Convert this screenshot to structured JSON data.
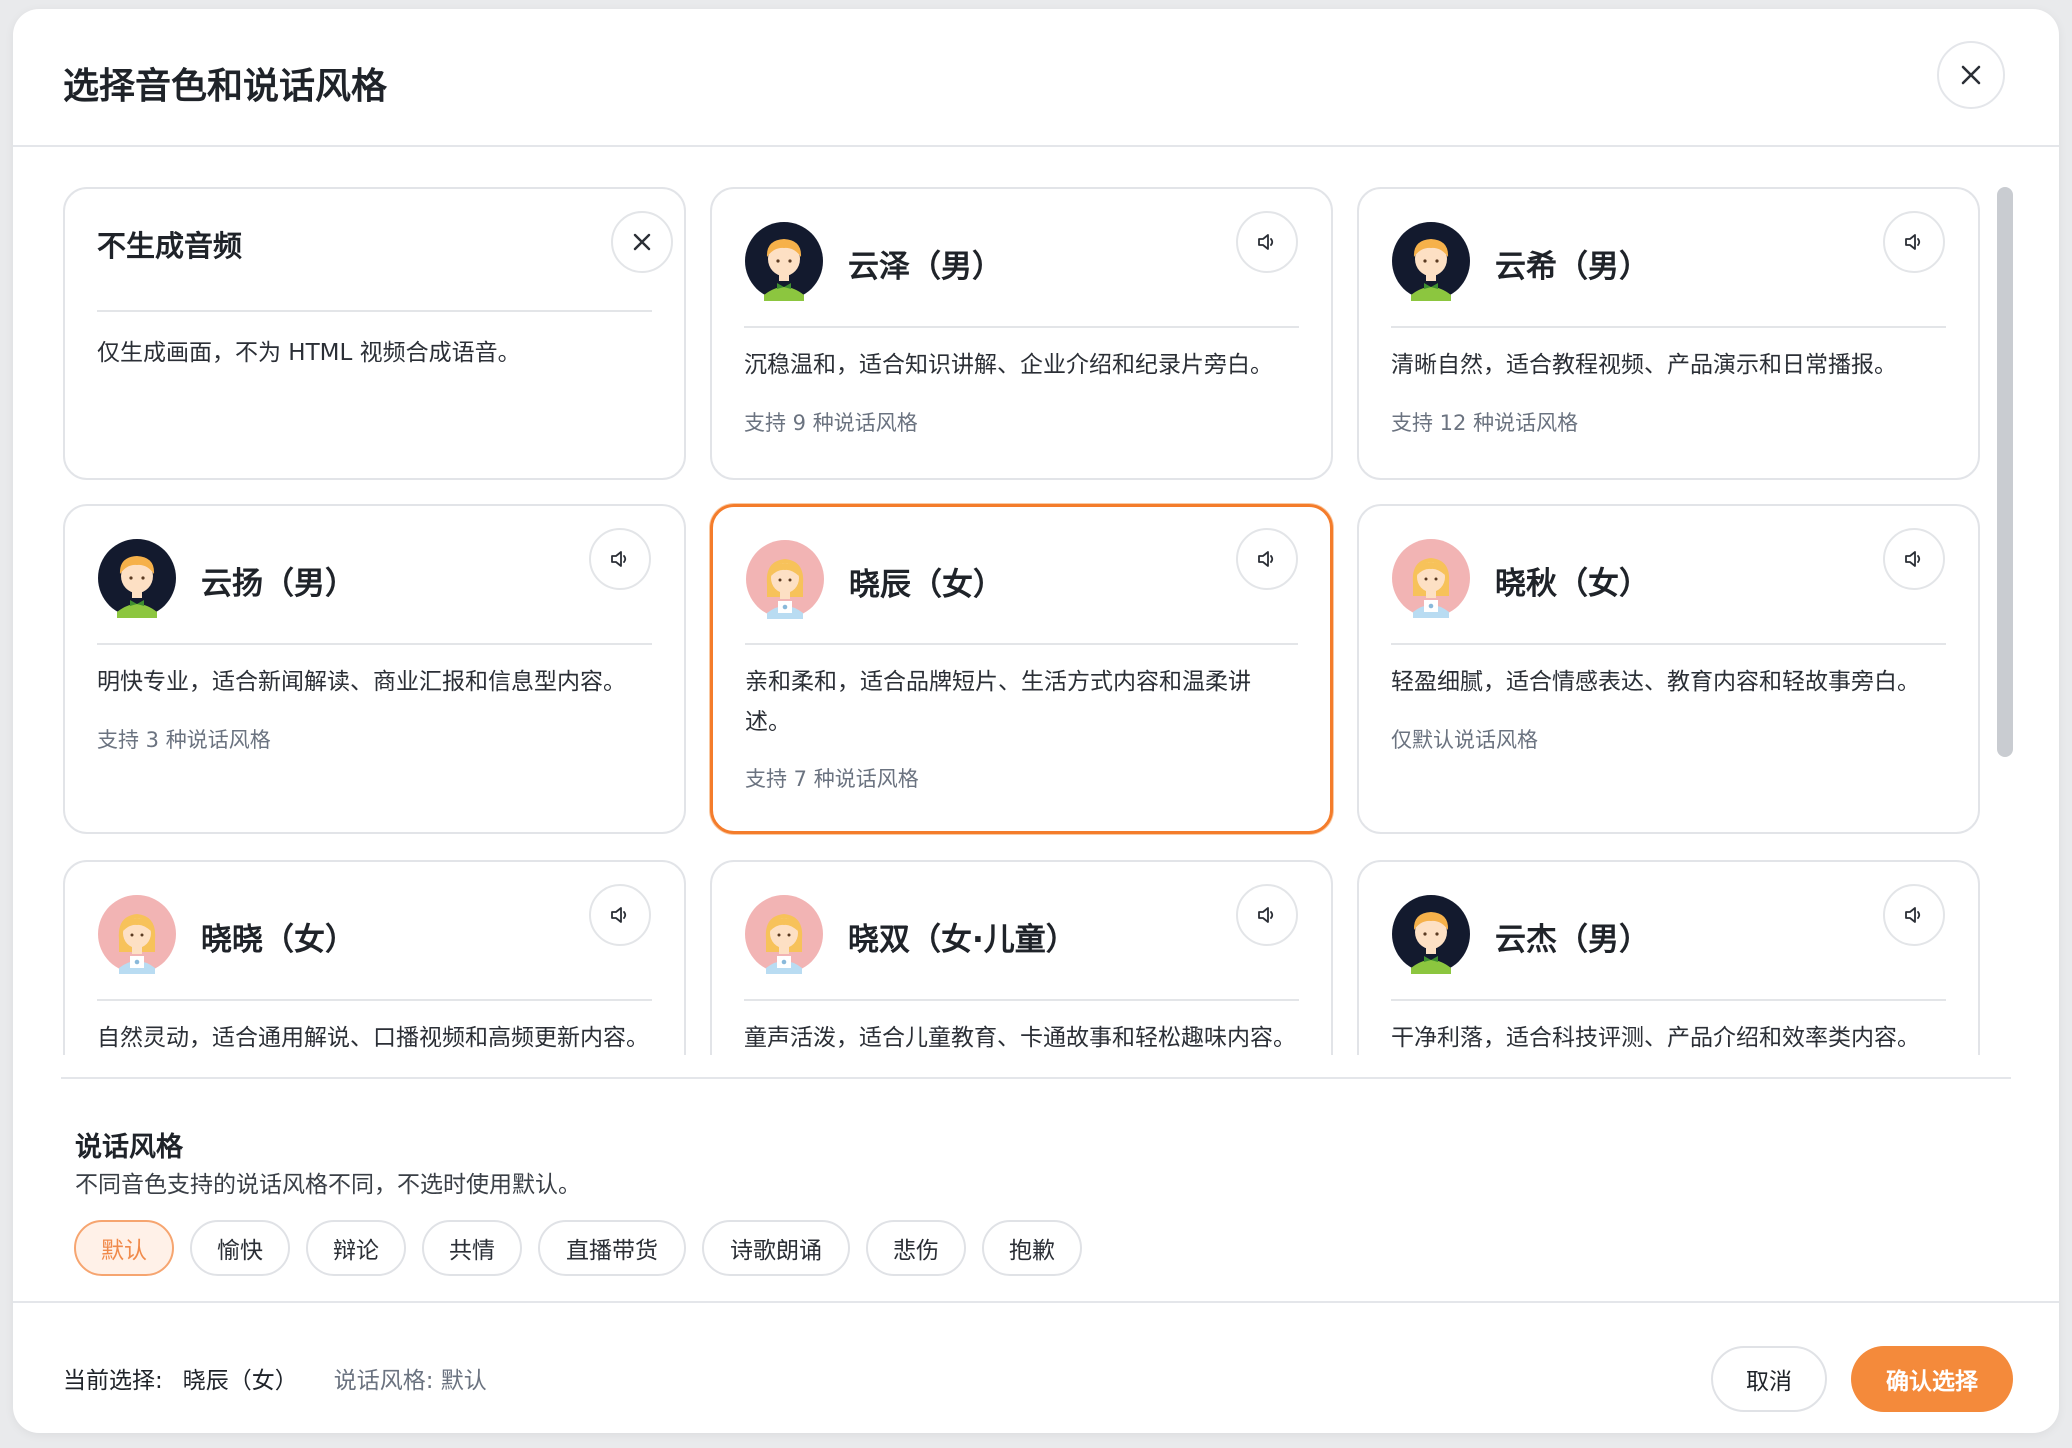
{
  "dialog": {
    "title": "选择音色和说话风格",
    "close_icon": "close-icon"
  },
  "colors": {
    "accent": "#f48a3b",
    "selected_border": "#f47c2b",
    "male_avatar_bg": "#131a2e",
    "female_avatar_bg": "#f2b4b4"
  },
  "no_audio": {
    "title": "不生成音频",
    "desc": "仅生成画面，不为 HTML 视频合成语音。",
    "icon": "close-icon"
  },
  "voices": [
    {
      "name": "云泽（男）",
      "desc": "沉稳温和，适合知识讲解、企业介绍和纪录片旁白。",
      "support": "支持 9 种说话风格",
      "gender": "male",
      "selected": false
    },
    {
      "name": "云希（男）",
      "desc": "清晰自然，适合教程视频、产品演示和日常播报。",
      "support": "支持 12 种说话风格",
      "gender": "male",
      "selected": false
    },
    {
      "name": "云扬（男）",
      "desc": "明快专业，适合新闻解读、商业汇报和信息型内容。",
      "support": "支持 3 种说话风格",
      "gender": "male",
      "selected": false
    },
    {
      "name": "晓辰（女）",
      "desc": "亲和柔和，适合品牌短片、生活方式内容和温柔讲述。",
      "support": "支持 7 种说话风格",
      "gender": "female",
      "selected": true
    },
    {
      "name": "晓秋（女）",
      "desc": "轻盈细腻，适合情感表达、教育内容和轻故事旁白。",
      "support": "仅默认说话风格",
      "gender": "female",
      "selected": false
    },
    {
      "name": "晓晓（女）",
      "desc": "自然灵动，适合通用解说、口播视频和高频更新内容。",
      "support": "",
      "gender": "female",
      "selected": false
    },
    {
      "name": "晓双（女·儿童）",
      "desc": "童声活泼，适合儿童教育、卡通故事和轻松趣味内容。",
      "support": "",
      "gender": "female",
      "selected": false
    },
    {
      "name": "云杰（男）",
      "desc": "干净利落，适合科技评测、产品介绍和效率类内容。",
      "support": "",
      "gender": "male",
      "selected": false
    }
  ],
  "speaker_icon": "speaker-icon",
  "style_section": {
    "title": "说话风格",
    "subtitle": "不同音色支持的说话风格不同，不选时使用默认。",
    "chips": [
      "默认",
      "愉快",
      "辩论",
      "共情",
      "直播带货",
      "诗歌朗诵",
      "悲伤",
      "抱歉"
    ],
    "active_chip": "默认"
  },
  "footer": {
    "current_label": "当前选择:",
    "current_value": "晓辰（女）",
    "style_text": "说话风格: 默认",
    "cancel_label": "取消",
    "confirm_label": "确认选择"
  }
}
